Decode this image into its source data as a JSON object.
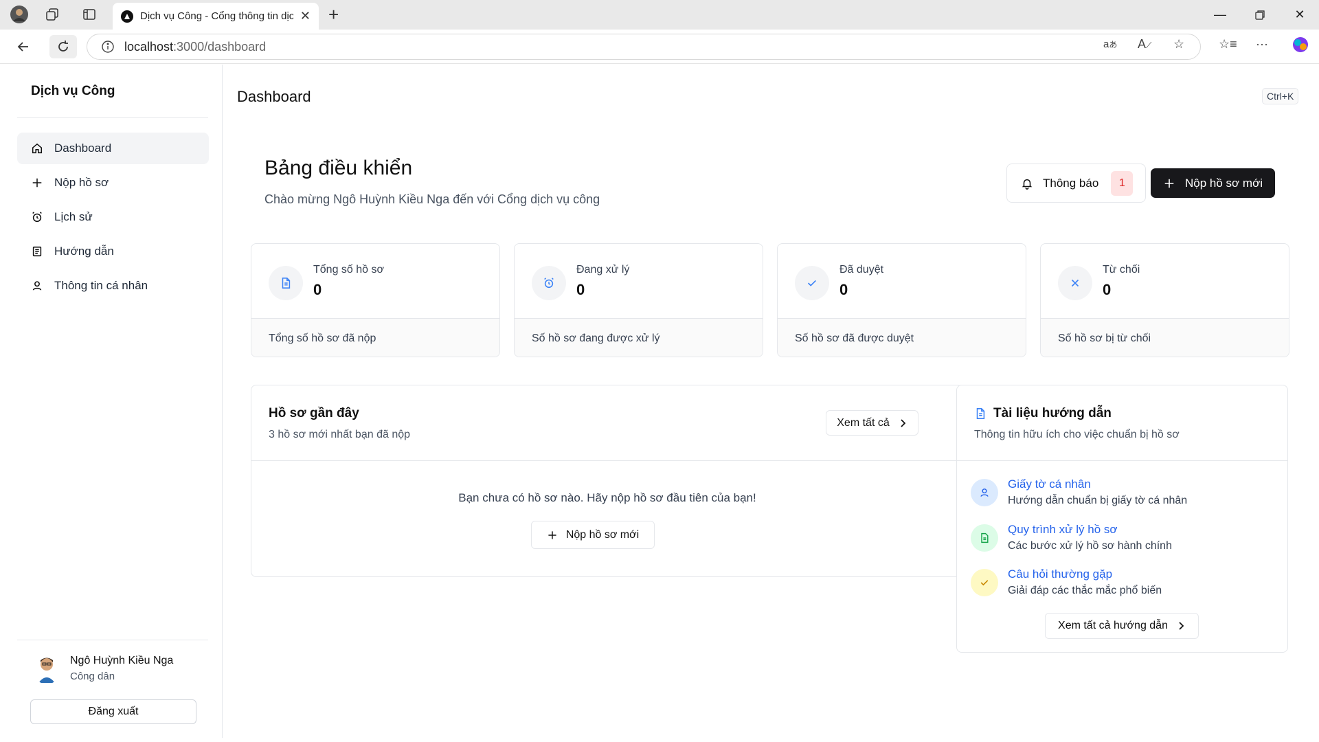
{
  "browser": {
    "tab_title": "Dịch vụ Công - Cổng thông tin dịch vụ công",
    "url_host": "localhost",
    "url_path": ":3000/dashboard"
  },
  "sidebar": {
    "brand": "Dịch vụ Công",
    "items": [
      {
        "label": "Dashboard",
        "icon": "home-icon"
      },
      {
        "label": "Nộp hồ sơ",
        "icon": "plus-icon"
      },
      {
        "label": "Lịch sử",
        "icon": "alarm-clock-icon"
      },
      {
        "label": "Hướng dẫn",
        "icon": "book-icon"
      },
      {
        "label": "Thông tin cá nhân",
        "icon": "user-icon"
      }
    ],
    "user": {
      "name": "Ngô Huỳnh Kiều Nga",
      "role": "Công dân"
    },
    "logout_label": "Đăng xuất"
  },
  "header": {
    "title": "Dashboard",
    "shortcut": "Ctrl+K"
  },
  "hero": {
    "title": "Bảng điều khiển",
    "welcome": "Chào mừng Ngô Huỳnh Kiều Nga đến với Cổng dịch vụ công",
    "notif_label": "Thông báo",
    "notif_count": "1",
    "new_label": "Nộp hồ sơ mới"
  },
  "stats": [
    {
      "label": "Tổng số hồ sơ",
      "value": "0",
      "footer": "Tổng số hồ sơ đã nộp",
      "icon": "document-icon",
      "color": "#3b82f6"
    },
    {
      "label": "Đang xử lý",
      "value": "0",
      "footer": "Số hồ sơ đang được xử lý",
      "icon": "alarm-clock-icon",
      "color": "#3b82f6"
    },
    {
      "label": "Đã duyệt",
      "value": "0",
      "footer": "Số hồ sơ đã được duyệt",
      "icon": "check-icon",
      "color": "#3b82f6"
    },
    {
      "label": "Từ chối",
      "value": "0",
      "footer": "Số hồ sơ bị từ chối",
      "icon": "x-icon",
      "color": "#3b82f6"
    }
  ],
  "recent": {
    "title": "Hồ sơ gần đây",
    "subtitle": "3 hồ sơ mới nhất bạn đã nộp",
    "view_all": "Xem tất cả",
    "empty": "Bạn chưa có hồ sơ nào. Hãy nộp hồ sơ đầu tiên của bạn!",
    "new_label": "Nộp hồ sơ mới"
  },
  "guide": {
    "title": "Tài liệu hướng dẫn",
    "subtitle": "Thông tin hữu ích cho việc chuẩn bị hồ sơ",
    "items": [
      {
        "title": "Giấy tờ cá nhân",
        "desc": "Hướng dẫn chuẩn bị giấy tờ cá nhân",
        "icon": "user-icon",
        "bg": "#dbeafe",
        "fg": "#2563eb"
      },
      {
        "title": "Quy trình xử lý hồ sơ",
        "desc": "Các bước xử lý hồ sơ hành chính",
        "icon": "file-text-icon",
        "bg": "#dcfce7",
        "fg": "#16a34a"
      },
      {
        "title": "Câu hỏi thường gặp",
        "desc": "Giải đáp các thắc mắc phổ biến",
        "icon": "check-icon",
        "bg": "#fef9c3",
        "fg": "#ca8a04"
      }
    ],
    "view_all": "Xem tất cả hướng dẫn"
  }
}
